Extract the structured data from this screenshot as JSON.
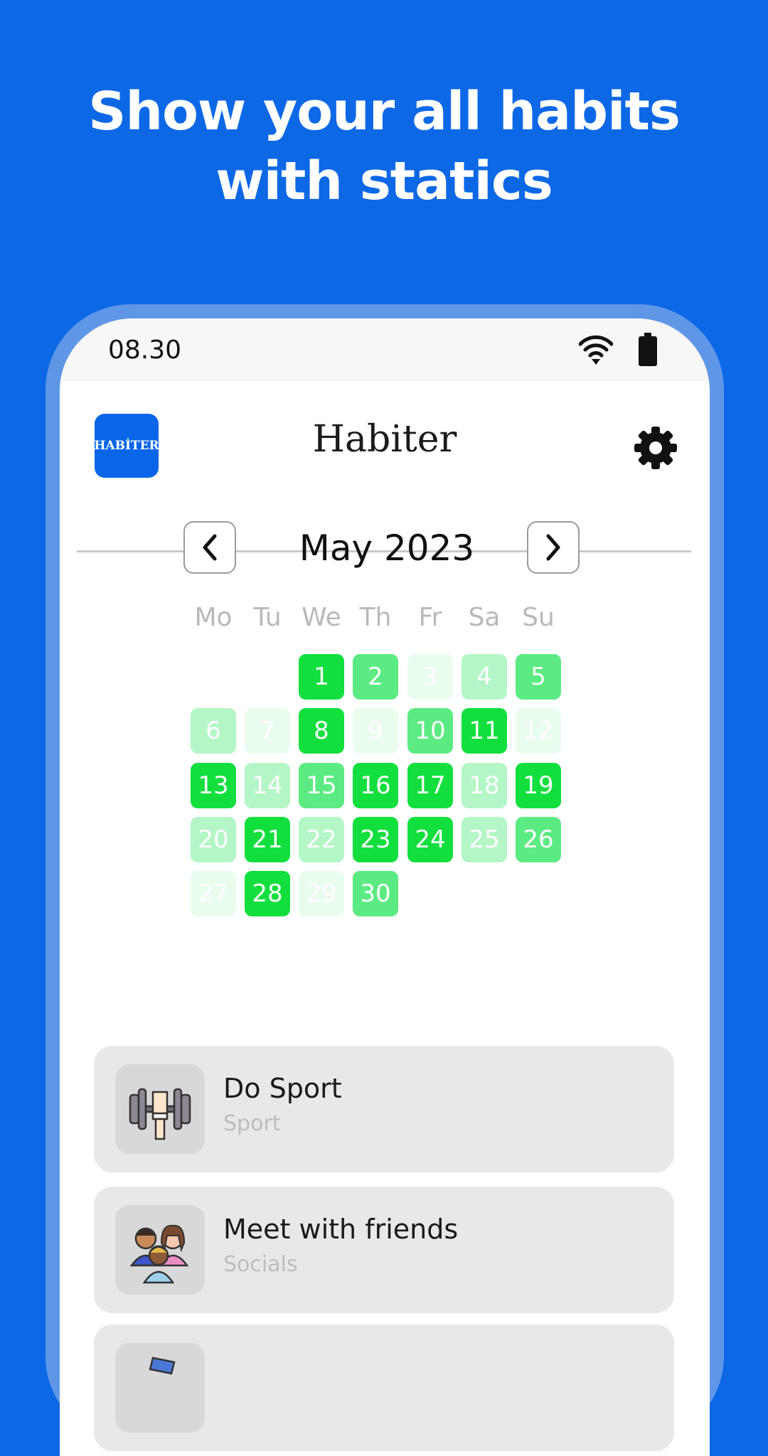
{
  "headline": {
    "line1": "Show your all habits",
    "line2": "with statics"
  },
  "status_bar": {
    "time": "08.30"
  },
  "app": {
    "logo_text": "HABİTER",
    "title": "Habiter"
  },
  "calendar": {
    "month_label": "May 2023",
    "weekdays": [
      "Mo",
      "Tu",
      "We",
      "Th",
      "Fr",
      "Sa",
      "Su"
    ],
    "first_weekday_index": 2,
    "levels": [
      4,
      3,
      1,
      2,
      3,
      2,
      1,
      4,
      1,
      3,
      4,
      1,
      4,
      2,
      3,
      4,
      4,
      2,
      4,
      2,
      4,
      2,
      4,
      4,
      2,
      3,
      1,
      4,
      1,
      3
    ],
    "colors": {
      "level1": "#eafcee",
      "level2": "#b4f6c6",
      "level3": "#5ceb82",
      "level4": "#12df3e"
    }
  },
  "habits": [
    {
      "name": "Do Sport",
      "category": "Sport",
      "icon": "dumbbell-icon"
    },
    {
      "name": "Meet with friends",
      "category": "Socials",
      "icon": "friends-icon"
    },
    {
      "name": "",
      "category": "",
      "icon": "book-icon"
    }
  ]
}
